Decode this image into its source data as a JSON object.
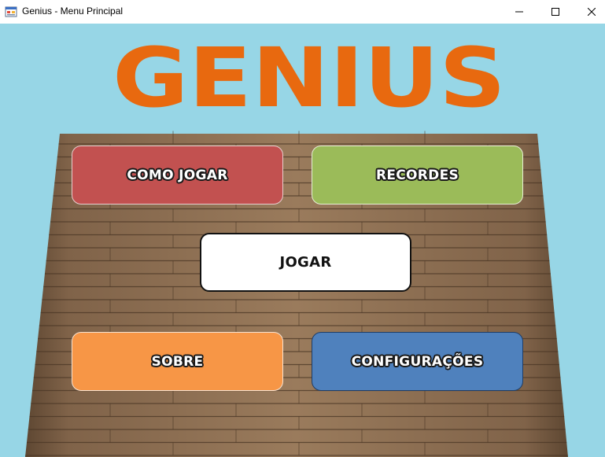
{
  "window": {
    "title": "Genius - Menu Principal",
    "controls": {
      "minimize": "minimize-icon",
      "maximize": "maximize-icon",
      "close": "close-icon"
    }
  },
  "logo": {
    "text": "GENIUS",
    "color": "#e8690f"
  },
  "background_color": "#97d6e6",
  "menu": {
    "como_jogar": "COMO JOGAR",
    "recordes": "RECORDES",
    "jogar": "JOGAR",
    "sobre": "SOBRE",
    "configuracoes": "CONFIGURAÇÕES"
  },
  "button_colors": {
    "como_jogar": "#c25150",
    "recordes": "#9bbb59",
    "jogar": "#ffffff",
    "sobre": "#f79646",
    "configuracoes": "#4f81bd"
  }
}
